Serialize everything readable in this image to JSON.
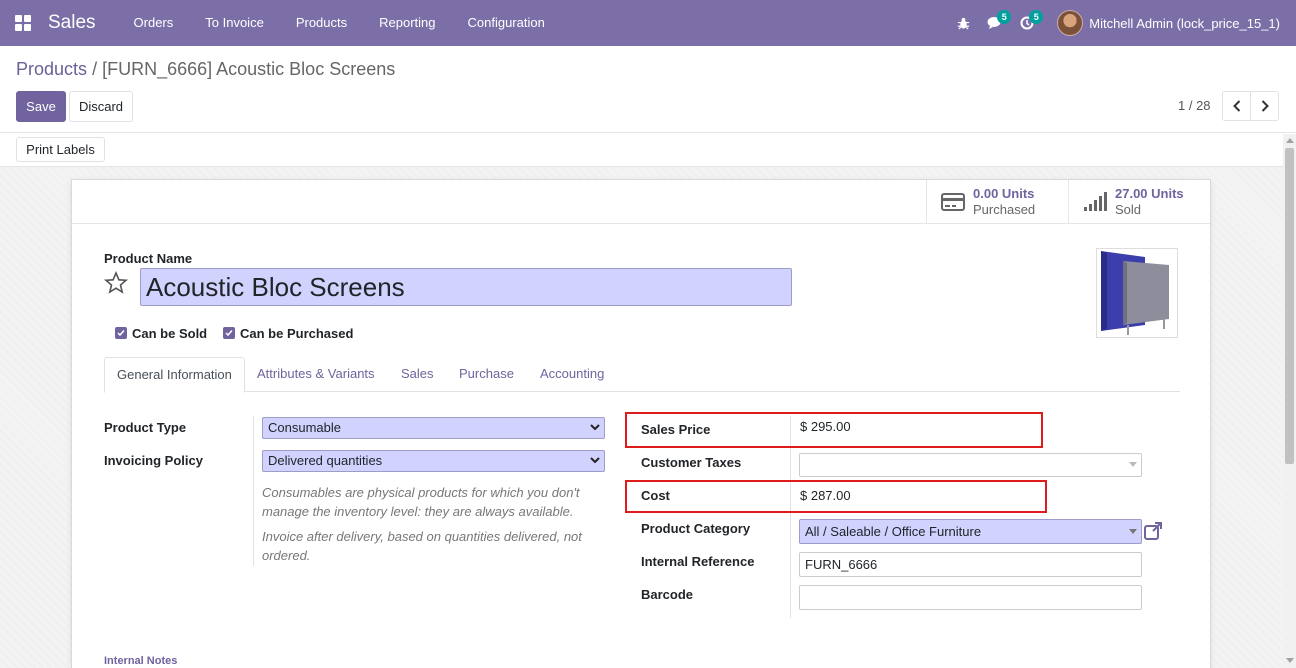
{
  "navbar": {
    "app_name": "Sales",
    "menu": [
      "Orders",
      "To Invoice",
      "Products",
      "Reporting",
      "Configuration"
    ],
    "messages_count": "5",
    "activities_count": "5",
    "user_name": "Mitchell Admin (lock_price_15_1)"
  },
  "breadcrumb": {
    "parent": "Products",
    "separator": "/",
    "current": "[FURN_6666] Acoustic Bloc Screens"
  },
  "actions": {
    "save_label": "Save",
    "discard_label": "Discard",
    "print_labels": "Print Labels"
  },
  "pager": {
    "text": "1 / 28"
  },
  "stat_buttons": [
    {
      "value": "0.00 Units",
      "label": "Purchased",
      "icon": "credit-card-icon"
    },
    {
      "value": "27.00 Units",
      "label": "Sold",
      "icon": "signal-bars-icon"
    }
  ],
  "product": {
    "name_label": "Product Name",
    "name": "Acoustic Bloc Screens",
    "can_be_sold_label": "Can be Sold",
    "can_be_sold": true,
    "can_be_purchased_label": "Can be Purchased",
    "can_be_purchased": true
  },
  "tabs": [
    "General Information",
    "Attributes & Variants",
    "Sales",
    "Purchase",
    "Accounting"
  ],
  "active_tab": "General Information",
  "left_fields": {
    "product_type_label": "Product Type",
    "product_type": "Consumable",
    "invoicing_policy_label": "Invoicing Policy",
    "invoicing_policy": "Delivered quantities",
    "help_consumable": "Consumables are physical products for which you don't manage the inventory level: they are always available.",
    "help_invoice": "Invoice after delivery, based on quantities delivered, not ordered."
  },
  "right_fields": {
    "sales_price_label": "Sales Price",
    "sales_price": "$ 295.00",
    "customer_taxes_label": "Customer Taxes",
    "customer_taxes": "",
    "cost_label": "Cost",
    "cost": "$ 287.00",
    "product_category_label": "Product Category",
    "product_category": "All / Saleable / Office Furniture",
    "internal_reference_label": "Internal Reference",
    "internal_reference": "FURN_6666",
    "barcode_label": "Barcode",
    "barcode": ""
  },
  "notes_label": "Internal Notes",
  "colors": {
    "brand": "#7c6fa8",
    "primary": "#71639e",
    "required_field": "#d2d2ff",
    "highlight": "#e01b1b",
    "badge": "#00a09d"
  }
}
